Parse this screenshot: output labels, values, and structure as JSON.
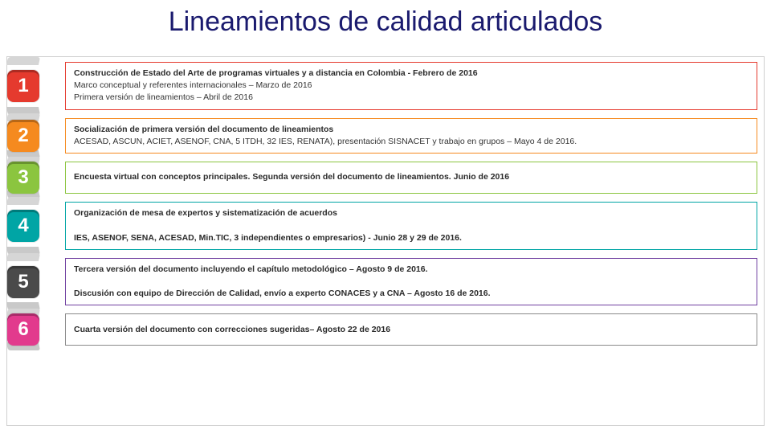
{
  "title": "Lineamientos de calidad articulados",
  "steps": [
    {
      "num": "1",
      "badgeColor": "#e53a2e",
      "borderColor": "#e53a2e",
      "lines": [
        {
          "bold": true,
          "text": "Construcción de Estado del Arte de programas virtuales y a distancia en Colombia  - Febrero de 2016"
        },
        {
          "bold": false,
          "text": "Marco conceptual y referentes internacionales – Marzo de 2016"
        },
        {
          "bold": false,
          "text": "Primera versión de lineamientos – Abril de 2016"
        }
      ]
    },
    {
      "num": "2",
      "badgeColor": "#f58a1f",
      "borderColor": "#f58a1f",
      "lines": [
        {
          "bold": true,
          "text": "Socialización de primera versión del documento de lineamientos"
        },
        {
          "bold": false,
          "text": "ACESAD, ASCUN, ACIET, ASENOF, CNA, 5 ITDH, 32 IES, RENATA), presentación SISNACET y trabajo en grupos – Mayo 4 de 2016."
        }
      ]
    },
    {
      "num": "3",
      "badgeColor": "#8bc53f",
      "borderColor": "#8bc53f",
      "lines": [
        {
          "bold": true,
          "text": "Encuesta virtual con conceptos principales. Segunda versión del documento de lineamientos.  Junio de 2016"
        }
      ]
    },
    {
      "num": "4",
      "badgeColor": "#00a5a5",
      "borderColor": "#00a5a5",
      "lines": [
        {
          "bold": true,
          "text": "Organización de mesa de expertos y sistematización de acuerdos"
        },
        {
          "bold": false,
          "text": ""
        },
        {
          "bold": true,
          "text": "IES, ASENOF, SENA, ACESAD, Min.TIC, 3 independientes o empresarios) - Junio 28 y 29 de 2016."
        }
      ]
    },
    {
      "num": "5",
      "badgeColor": "#4a4a4a",
      "borderColor": "#6f3fa0",
      "lines": [
        {
          "bold": true,
          "text": "Tercera versión del documento incluyendo el capítulo metodológico – Agosto 9 de 2016."
        },
        {
          "bold": false,
          "text": ""
        },
        {
          "bold": true,
          "text": "Discusión con equipo de Dirección de Calidad, envío a experto CONACES y a CNA – Agosto 16 de 2016."
        }
      ]
    },
    {
      "num": "6",
      "badgeColor": "#e23a8d",
      "borderColor": "#8a8a8a",
      "lines": [
        {
          "bold": true,
          "text": "Cuarta versión del documento con correcciones sugeridas– Agosto 22 de 2016"
        }
      ]
    }
  ]
}
